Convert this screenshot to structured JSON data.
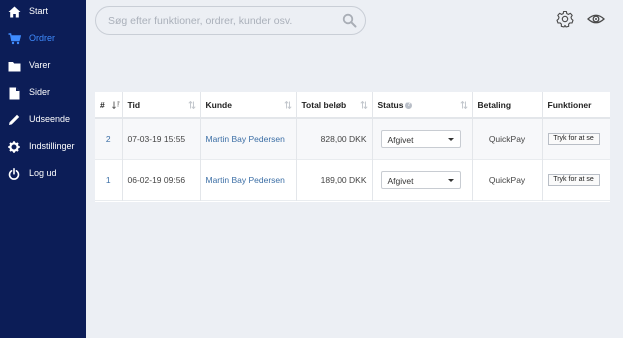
{
  "sidebar": {
    "items": [
      {
        "label": "Start",
        "icon": "home-icon"
      },
      {
        "label": "Ordrer",
        "icon": "cart-icon",
        "active": true
      },
      {
        "label": "Varer",
        "icon": "folder-icon"
      },
      {
        "label": "Sider",
        "icon": "file-icon"
      },
      {
        "label": "Udseende",
        "icon": "pencil-icon"
      },
      {
        "label": "Indstillinger",
        "icon": "gear-icon"
      },
      {
        "label": "Log ud",
        "icon": "power-icon"
      }
    ],
    "background": "#0c1d57",
    "active_color": "#3f8cff"
  },
  "search": {
    "placeholder": "Søg efter funktioner, ordrer, kunder osv."
  },
  "header": {
    "settings_icon": "gear-icon",
    "preview_icon": "eye-icon"
  },
  "table": {
    "headers": {
      "num": "#",
      "time": "Tid",
      "customer": "Kunde",
      "total": "Total beløb",
      "status": "Status",
      "payment": "Betaling",
      "functions": "Funktioner"
    },
    "rows": [
      {
        "num": "2",
        "time": "07-03-19 15:55",
        "customer": "Martin Bay Pedersen",
        "total": "828,00 DKK",
        "status": "Afgivet",
        "payment": "QuickPay",
        "action": "Tryk for at se"
      },
      {
        "num": "1",
        "time": "06-02-19 09:56",
        "customer": "Martin Bay Pedersen",
        "total": "189,00 DKK",
        "status": "Afgivet",
        "payment": "QuickPay",
        "action": "Tryk for at se"
      }
    ]
  }
}
